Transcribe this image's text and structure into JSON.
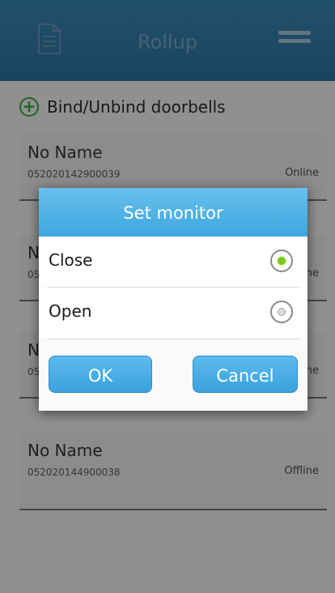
{
  "header": {
    "title": "Rollup",
    "left_icon": "document-icon",
    "right_icon": "menu-icon"
  },
  "bind_row": {
    "icon": "plus-circle-icon",
    "label": "Bind/Unbind doorbells"
  },
  "devices": [
    {
      "name": "No Name",
      "serial": "052020142900039",
      "status": "Online"
    },
    {
      "name": "N",
      "serial": "05",
      "status": "ne"
    },
    {
      "name": "N",
      "serial": "05",
      "status": "ne"
    },
    {
      "name": "No Name",
      "serial": "052020144900038",
      "status": "Offline"
    }
  ],
  "dialog": {
    "title": "Set monitor",
    "options": [
      {
        "label": "Close",
        "selected": true
      },
      {
        "label": "Open",
        "selected": false
      }
    ],
    "ok_label": "OK",
    "cancel_label": "Cancel"
  },
  "colors": {
    "header_bg": "#2a76a9",
    "dialog_header_bg": "#4fb2e6",
    "radio_selected": "#7cc91e",
    "bind_icon": "#2aa534"
  }
}
